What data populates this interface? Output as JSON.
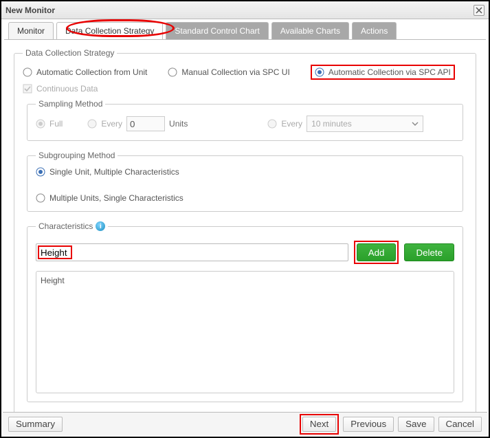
{
  "title": "New Monitor",
  "tabs": {
    "monitor": "Monitor",
    "dcs": "Data Collection Strategy",
    "scc": "Standard Control Chart",
    "avail": "Available Charts",
    "actions": "Actions"
  },
  "fs": {
    "dcs_legend": "Data Collection Strategy",
    "opt_auto_unit": "Automatic Collection from Unit",
    "opt_manual": "Manual Collection via SPC UI",
    "opt_auto_api": "Automatic Collection via SPC API",
    "continuous": "Continuous Data",
    "sampling": {
      "legend": "Sampling Method",
      "full": "Full",
      "every": "Every",
      "units": "Units",
      "every2": "Every",
      "interval": "10 minutes",
      "num": "0"
    },
    "subgroup": {
      "legend": "Subgrouping Method",
      "single": "Single Unit, Multiple Characteristics",
      "multi": "Multiple Units, Single Characteristics"
    },
    "chars": {
      "legend": "Characteristics",
      "input": "Height",
      "add": "Add",
      "del": "Delete",
      "items": [
        "Height"
      ]
    }
  },
  "footer": {
    "summary": "Summary",
    "next": "Next",
    "prev": "Previous",
    "save": "Save",
    "cancel": "Cancel"
  }
}
